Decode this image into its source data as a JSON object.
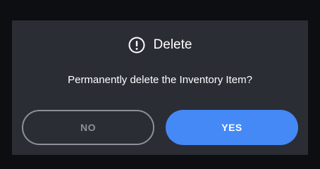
{
  "dialog": {
    "title": "Delete",
    "icon": "alert-circle-icon",
    "message": "Permanently delete the Inventory Item?",
    "buttons": {
      "no_label": "NO",
      "yes_label": "YES"
    }
  },
  "colors": {
    "backdrop": "#0d0e12",
    "dialog_background": "#2b2d35",
    "primary": "#4589f7",
    "secondary_outline": "#8e9097",
    "text": "#ffffff"
  }
}
